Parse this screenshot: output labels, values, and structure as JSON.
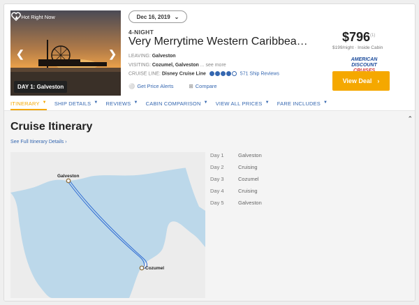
{
  "header": {
    "hot_badge": "Hot Right Now",
    "day_badge": "DAY 1: Galveston",
    "date": "Dec 16, 2019",
    "nights": "4-NIGHT",
    "title": "Very Merrytime Western Caribbean Crui...",
    "leaving_label": "LEAVING:",
    "leaving_value": "Galveston",
    "visiting_label": "VISITING:",
    "visiting_value": "Cozumel, Galveston",
    "visiting_more": "... see more",
    "line_label": "CRUISE LINE:",
    "line_value": "Disney Cruise Line",
    "rating": 4,
    "reviews": "571 Ship Reviews",
    "price_alerts": "Get Price Alerts",
    "compare": "Compare",
    "price": "$796",
    "price_sup": "(1)",
    "per_night": "$199/night · Inside Cabin",
    "brand_line1": "AMERICAN DISCOUNT",
    "brand_line2": "CRUISES",
    "deal_button": "View Deal",
    "accent_color": "#f5a800"
  },
  "tabs": [
    {
      "label": "ITINERARY",
      "active": true
    },
    {
      "label": "SHIP DETAILS",
      "active": false
    },
    {
      "label": "REVIEWS",
      "active": false
    },
    {
      "label": "CABIN COMPARISON",
      "active": false
    },
    {
      "label": "VIEW ALL PRICES",
      "active": false
    },
    {
      "label": "FARE INCLUDES",
      "active": false
    }
  ],
  "itinerary": {
    "title": "Cruise Itinerary",
    "full_link": "See Full Itinerary Details ›",
    "map_labels": {
      "start": "Galveston",
      "end": "Cozumel"
    },
    "days": [
      {
        "day": "Day 1",
        "port": "Galveston"
      },
      {
        "day": "Day 2",
        "port": "Cruising"
      },
      {
        "day": "Day 3",
        "port": "Cozumel"
      },
      {
        "day": "Day 4",
        "port": "Cruising"
      },
      {
        "day": "Day 5",
        "port": "Galveston"
      }
    ]
  }
}
